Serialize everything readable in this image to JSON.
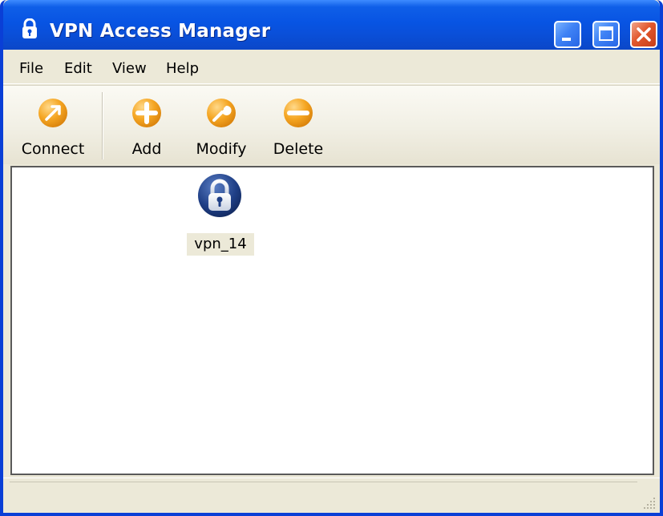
{
  "window": {
    "title": "VPN Access Manager"
  },
  "menu": {
    "items": [
      "File",
      "Edit",
      "View",
      "Help"
    ]
  },
  "toolbar": {
    "connect_label": "Connect",
    "add_label": "Add",
    "modify_label": "Modify",
    "delete_label": "Delete",
    "icon_color": "#f5a623"
  },
  "connections": [
    {
      "name": "vpn_14",
      "icon": "padlock-icon"
    }
  ],
  "colors": {
    "titlebar": "#0854e3",
    "close_button": "#e2572c",
    "window_face": "#ece9d8"
  }
}
